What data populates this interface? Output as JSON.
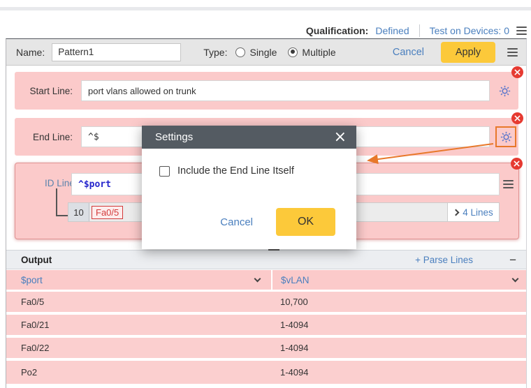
{
  "topbar": {
    "qualification_label": "Qualification:",
    "qualification_value": "Defined",
    "test_on_devices": "Test on Devices: 0"
  },
  "pattern_header": {
    "name_label": "Name:",
    "name_value": "Pattern1",
    "type_label": "Type:",
    "type_options": [
      {
        "label": "Single",
        "selected": false
      },
      {
        "label": "Multiple",
        "selected": true
      }
    ],
    "cancel_label": "Cancel",
    "apply_label": "Apply"
  },
  "start_line": {
    "label": "Start Line:",
    "value": "port vlans allowed on trunk"
  },
  "end_line": {
    "label": "End Line:",
    "value": "^$"
  },
  "id_line": {
    "label": "ID Line",
    "value": "^$port",
    "sample_number": "10",
    "sample_token": "Fa0/5",
    "lines_label": "4 Lines"
  },
  "modal": {
    "title": "Settings",
    "checkbox_label": "Include the End Line Itself",
    "checkbox_checked": false,
    "cancel_label": "Cancel",
    "ok_label": "OK",
    "close_glyph": "×"
  },
  "output": {
    "title": "Output",
    "parse_lines_label": "+ Parse Lines",
    "minus_glyph": "−",
    "columns": [
      "$port",
      "$vLAN"
    ],
    "rows": [
      {
        "port": "Fa0/5",
        "vlan": "10,700"
      },
      {
        "port": "Fa0/21",
        "vlan": "1-4094"
      },
      {
        "port": "Fa0/22",
        "vlan": "1-4094"
      },
      {
        "port": "Po2",
        "vlan": "1-4094"
      }
    ]
  },
  "colors": {
    "accent_yellow": "#fcc93a",
    "pink": "#fbcaca",
    "link_blue": "#4a7fbe",
    "highlight_orange": "#e8782a",
    "badge_red": "#e63a31",
    "modal_header": "#545b62",
    "gear_blue": "#5f79cc"
  }
}
